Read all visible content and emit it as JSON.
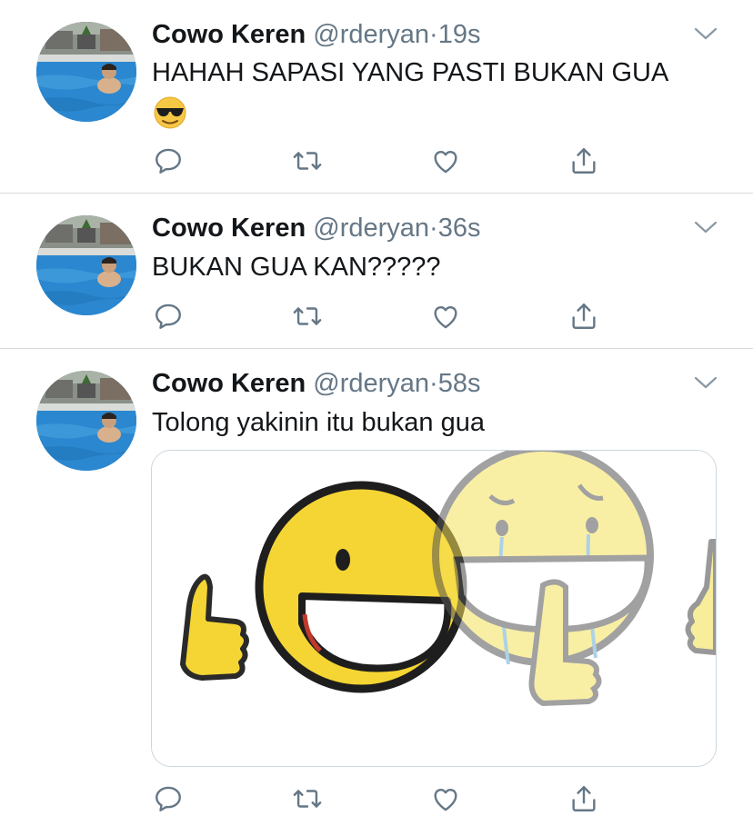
{
  "tweets": [
    {
      "display_name": "Cowo Keren",
      "handle": "@rderyan",
      "separator": "·",
      "time": "19s",
      "text": "HAHAH SAPASI YANG PASTI BUKAN GUA",
      "emoji": "smiling-face-with-sunglasses"
    },
    {
      "display_name": "Cowo Keren",
      "handle": "@rderyan",
      "separator": "·",
      "time": "36s",
      "text": "BUKAN GUA KAN?????"
    },
    {
      "display_name": "Cowo Keren",
      "handle": "@rderyan",
      "separator": "·",
      "time": "58s",
      "text": "Tolong yakinin itu bukan gua",
      "media": "thumbs-up-smiley-to-crying-smiley-image"
    }
  ],
  "colors": {
    "text": "#14171a",
    "secondary": "#657786",
    "divider": "#d6dadd",
    "emoji_yellow": "#f5d533"
  }
}
